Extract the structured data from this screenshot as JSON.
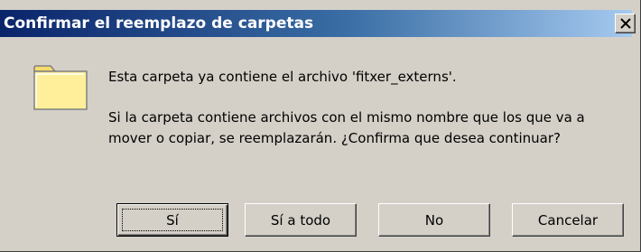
{
  "window": {
    "title": "Confirmar el reemplazo de carpetas",
    "close_label": "Cerrar"
  },
  "icons": {
    "folder": "folder-icon",
    "close": "close-icon"
  },
  "message": {
    "line1": "Esta carpeta ya contiene el archivo 'fitxer_externs'.",
    "line2": "Si la carpeta contiene archivos con el mismo nombre que los que va a",
    "line3": "mover o copiar, se reemplazarán. ¿Confirma que desea continuar?"
  },
  "buttons": {
    "yes": "Sí",
    "yes_to_all": "Sí a todo",
    "no": "No",
    "cancel": "Cancelar",
    "default": "yes"
  },
  "colors": {
    "titlebar_start": "#0a246a",
    "titlebar_end": "#a6caf0",
    "dialog_bg": "#d4d0c8",
    "folder_fill": "#ffef9a"
  }
}
